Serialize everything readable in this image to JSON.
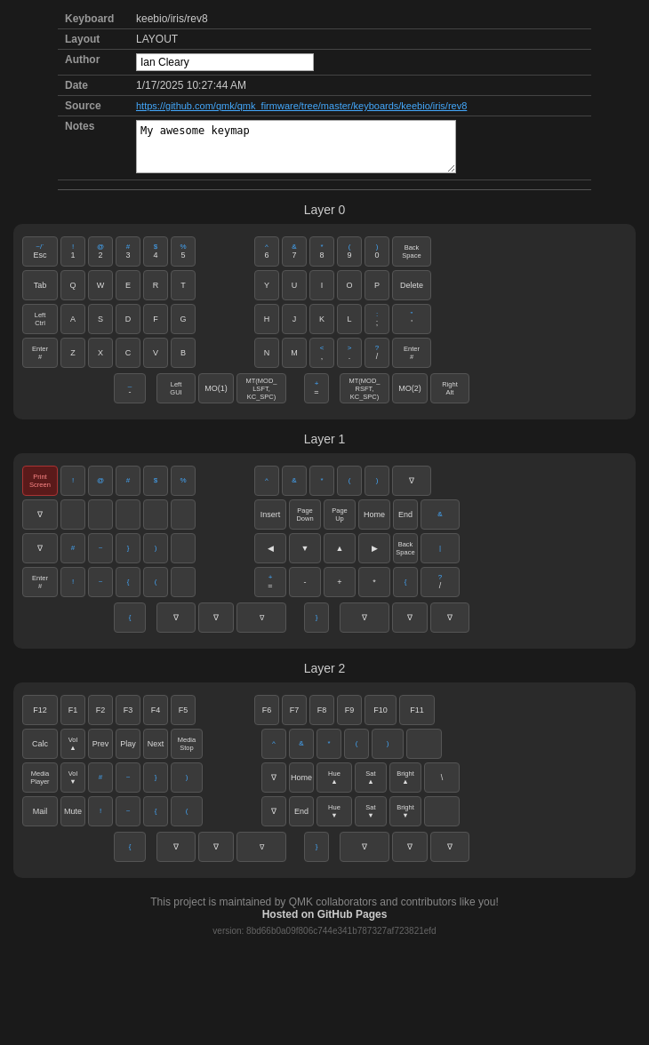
{
  "info": {
    "keyboard_label": "Keyboard",
    "keyboard_value": "keebio/iris/rev8",
    "layout_label": "Layout",
    "layout_value": "LAYOUT",
    "author_label": "Author",
    "author_value": "Ian Cleary",
    "date_label": "Date",
    "date_value": "1/17/2025 10:27:44 AM",
    "source_label": "Source",
    "source_value": "https://github.com/qmk/qmk_firmware/tree/master/keyboards/keebio/iris/rev8",
    "notes_label": "Notes",
    "notes_value": "My awesome keymap"
  },
  "layers": {
    "layer0_title": "Layer 0",
    "layer1_title": "Layer 1",
    "layer2_title": "Layer 2"
  },
  "footer": {
    "maintained": "This project is maintained by QMK collaborators and contributors like you!",
    "hosted": "Hosted on GitHub Pages",
    "version": "version: 8bd66b0a09f806c744e341b787327af723821efd"
  }
}
